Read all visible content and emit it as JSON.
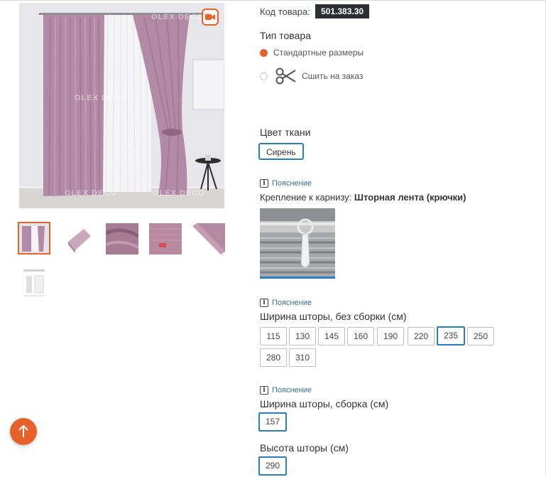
{
  "product": {
    "code_label": "Код товара:",
    "code_value": "501.383.30"
  },
  "product_type": {
    "title": "Тип товара",
    "options": [
      {
        "label": "Стандартные размеры",
        "selected": true
      },
      {
        "label": "Сшить на заказ",
        "selected": false
      }
    ]
  },
  "fabric_color": {
    "title": "Цвет ткани",
    "value": "Сирень"
  },
  "hint_label": "Пояснение",
  "hint_icon_glyph": "i",
  "mounting": {
    "label": "Крепление к карнизу:",
    "value": "Шторная лента (крючки)"
  },
  "width_unassembled": {
    "title": "Ширина шторы, без сборки (см)",
    "options": [
      "115",
      "130",
      "145",
      "160",
      "190",
      "220",
      "235",
      "250",
      "280",
      "310"
    ],
    "selected": "235"
  },
  "width_assembled": {
    "title": "Ширина шторы, сборка (см)",
    "value": "157"
  },
  "height": {
    "title": "Высота шторы (см)",
    "value": "290"
  },
  "watermark": "OLEX DECO",
  "colors": {
    "accent": "#e5622a",
    "selected_border": "#2a7fbf",
    "code_badge_bg": "#2b2f33",
    "curtain": "#b38aa5"
  },
  "icons": [
    "video-icon",
    "scissors-icon",
    "arrow-up-icon",
    "info-icon"
  ]
}
